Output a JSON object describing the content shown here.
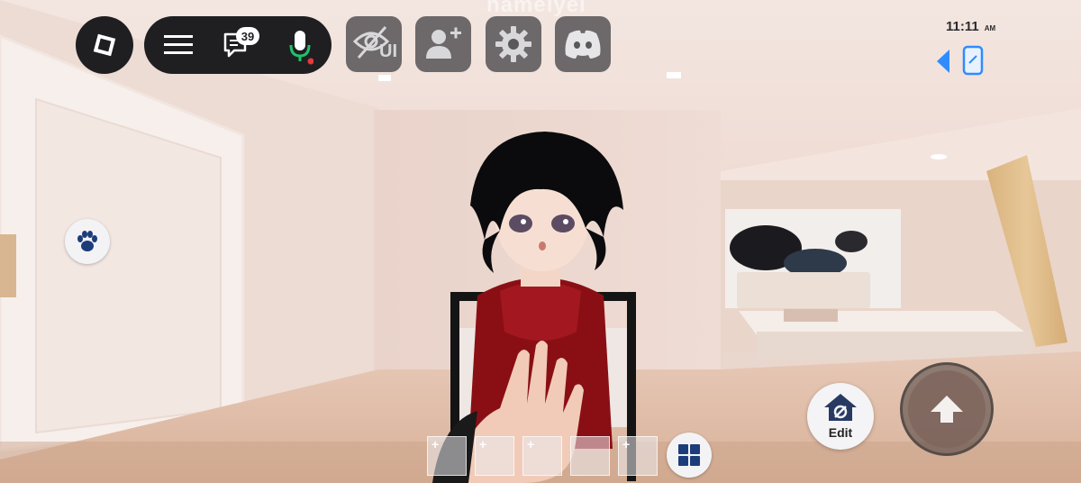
{
  "overlay": {
    "player_name": "namelyei",
    "time": "11:11",
    "time_suffix": "AM"
  },
  "topbar": {
    "roblox_menu_icon": "roblox-logo-icon",
    "menu_icon": "hamburger-menu-icon",
    "chat_icon": "chat-bubble-icon",
    "chat_badge_count": "39",
    "mic_icon": "microphone-icon",
    "hide_ui_label": "UI",
    "hide_ui_icon": "eye-slash-icon",
    "add_friend_icon": "add-friend-icon",
    "settings_icon": "gear-icon",
    "discord_icon": "discord-icon"
  },
  "right_panel": {
    "collapse_icon": "left-arrow-icon",
    "phone_icon": "phone-icon"
  },
  "left_panel": {
    "pet_icon": "paw-icon"
  },
  "bottom": {
    "edit_label": "Edit",
    "edit_icon": "house-edit-icon",
    "jump_icon": "jump-arrow-icon",
    "inventory_icon": "grid-icon",
    "slots": [
      "+",
      "+",
      "+",
      "",
      "+"
    ]
  },
  "colors": {
    "mic_green": "#1ec36a",
    "mic_red_dot": "#e23b3b",
    "phone_blue": "#2f8cff",
    "dark_pill": "#1f1f22"
  }
}
